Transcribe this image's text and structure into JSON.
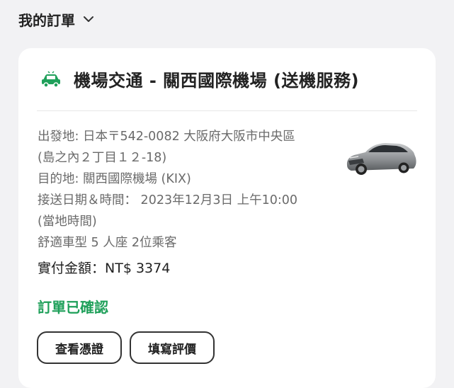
{
  "header": {
    "title": "我的訂單"
  },
  "order": {
    "title": "機場交通 - 關西國際機場 (送機服務)",
    "details": [
      "出發地: 日本〒542-0082 大阪府大阪市中央區",
      "(島之內２丁目１２-18)",
      "目的地: 關西國際機場 (KIX)",
      "接送日期＆時間： 2023年12月3日 上午10:00",
      "(當地時間)",
      "舒適車型 5 人座 2位乘客"
    ],
    "amount": "實付金額：NT$ 3374",
    "status": "訂單已確認",
    "buttons": {
      "voucher": "查看憑證",
      "review": "填寫評價"
    }
  },
  "colors": {
    "status_green": "#1fa05a",
    "icon_green": "#1fa05a",
    "background": "#f2f2f4",
    "card": "#ffffff"
  },
  "icons": {
    "title_icon": "car-icon",
    "header_icon": "chevron-down-icon"
  }
}
